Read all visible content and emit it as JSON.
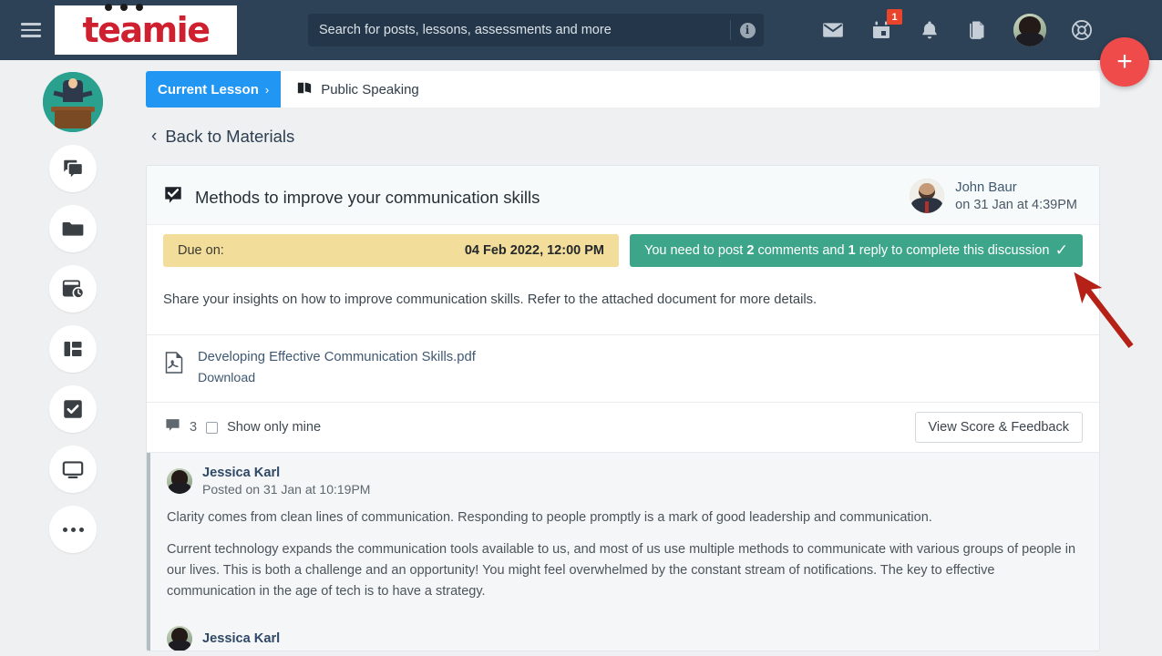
{
  "colors": {
    "topbar": "#2d4256",
    "brand_red": "#cf2030",
    "accent_blue": "#2196f3",
    "green_banner": "#3da68a",
    "due_yellow": "#f3dd9a",
    "fab_red": "#f04b4b",
    "badge_red": "#e8452c",
    "arrow_red": "#b52116"
  },
  "topbar": {
    "menu_icon": "hamburger-icon",
    "logo_text": "teamie",
    "search": {
      "placeholder": "Search for posts, lessons, assessments and more",
      "value": "",
      "info_char": "i"
    },
    "icons": [
      {
        "name": "mail-icon",
        "label": "Messages"
      },
      {
        "name": "calendar-icon",
        "label": "Calendar",
        "badge": "1"
      },
      {
        "name": "bell-icon",
        "label": "Notifications"
      },
      {
        "name": "pages-icon",
        "label": "Pages"
      }
    ],
    "avatar": {
      "name": "user-avatar",
      "label": "Account"
    },
    "help_icon": {
      "name": "lifebuoy-icon",
      "label": "Help"
    },
    "fab": {
      "name": "create-button",
      "label": "+"
    }
  },
  "sidebar": {
    "course_avatar_label": "Public Speaking course",
    "items": [
      {
        "icon": "chat-bubbles-icon",
        "label": "Discussions"
      },
      {
        "icon": "folder-icon",
        "label": "Materials"
      },
      {
        "icon": "calendar-clock-icon",
        "label": "Schedule"
      },
      {
        "icon": "dashboard-icon",
        "label": "Dashboard"
      },
      {
        "icon": "check-square-icon",
        "label": "Assessments"
      },
      {
        "icon": "monitor-icon",
        "label": "Classroom"
      },
      {
        "icon": "more-dots-icon",
        "label": "More"
      }
    ]
  },
  "breadcrumb": {
    "current_label": "Current Lesson",
    "chevron": "›",
    "lesson_icon": "book-icon",
    "lesson_label": "Public Speaking"
  },
  "back_link": {
    "chevron": "‹",
    "label": "Back to Materials"
  },
  "post": {
    "title_icon": "discussion-check-icon",
    "title": "Methods to improve your communication skills",
    "author": {
      "name": "John Baur",
      "date": "on 31 Jan at 4:39PM"
    },
    "due": {
      "label": "Due on:",
      "value": "04 Feb 2022, 12:00 PM"
    },
    "requirement": {
      "prefix": "You need to post",
      "comments_count": "2",
      "middle": "comments and",
      "replies_count": "1",
      "suffix": "reply to complete this discussion",
      "check": "✓"
    },
    "description": "Share your insights on how to improve communication skills. Refer to the attached document for more details.",
    "attachment": {
      "icon": "pdf-file-icon",
      "name": "Developing Effective Communication Skills.pdf",
      "download_label": "Download"
    },
    "comment_bar": {
      "icon": "comment-icon",
      "count": "3",
      "filter_label": "Show only mine",
      "filter_checked": false,
      "score_button": "View Score & Feedback"
    }
  },
  "comments": [
    {
      "author": "Jessica Karl",
      "date": "Posted on 31 Jan at 10:19PM",
      "paragraphs": [
        "Clarity comes from clean lines of communication. Responding to people promptly is a mark of good leadership and communication.",
        "Current technology expands the communication tools available to us, and most of us use multiple methods to communicate with various groups of people in our lives. This is both a challenge and an opportunity! You might feel overwhelmed by the constant stream of notifications. The key to effective communication in the age of tech is to have a strategy."
      ]
    },
    {
      "author": "Jessica Karl",
      "date": "",
      "paragraphs": []
    }
  ],
  "annotation": {
    "type": "arrow",
    "points_to": "requirement-banner-check"
  }
}
